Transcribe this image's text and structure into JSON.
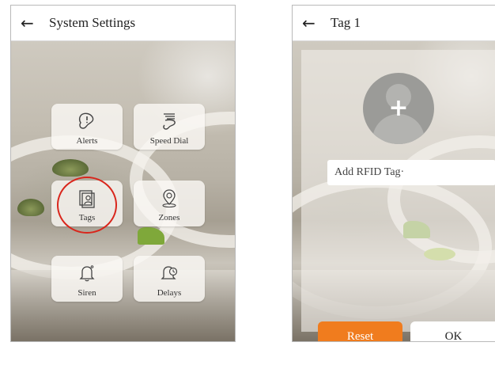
{
  "left_screen": {
    "title": "System Settings",
    "back_glyph": "←",
    "tiles": [
      {
        "label": "Alerts",
        "icon": "alerts-icon"
      },
      {
        "label": "Speed Dial",
        "icon": "speed-dial-icon"
      },
      {
        "label": "Tags",
        "icon": "tags-icon"
      },
      {
        "label": "Zones",
        "icon": "zones-icon"
      },
      {
        "label": "Siren",
        "icon": "siren-icon"
      },
      {
        "label": "Delays",
        "icon": "delays-icon"
      }
    ],
    "highlight_color": "#d9261c"
  },
  "right_screen": {
    "title": "Tag 1",
    "back_glyph": "←",
    "avatar_plus": "+",
    "rfid_label": "Add RFID Tag·",
    "reset_label": "Reset",
    "ok_label": "OK",
    "reset_color": "#f07c1e"
  }
}
